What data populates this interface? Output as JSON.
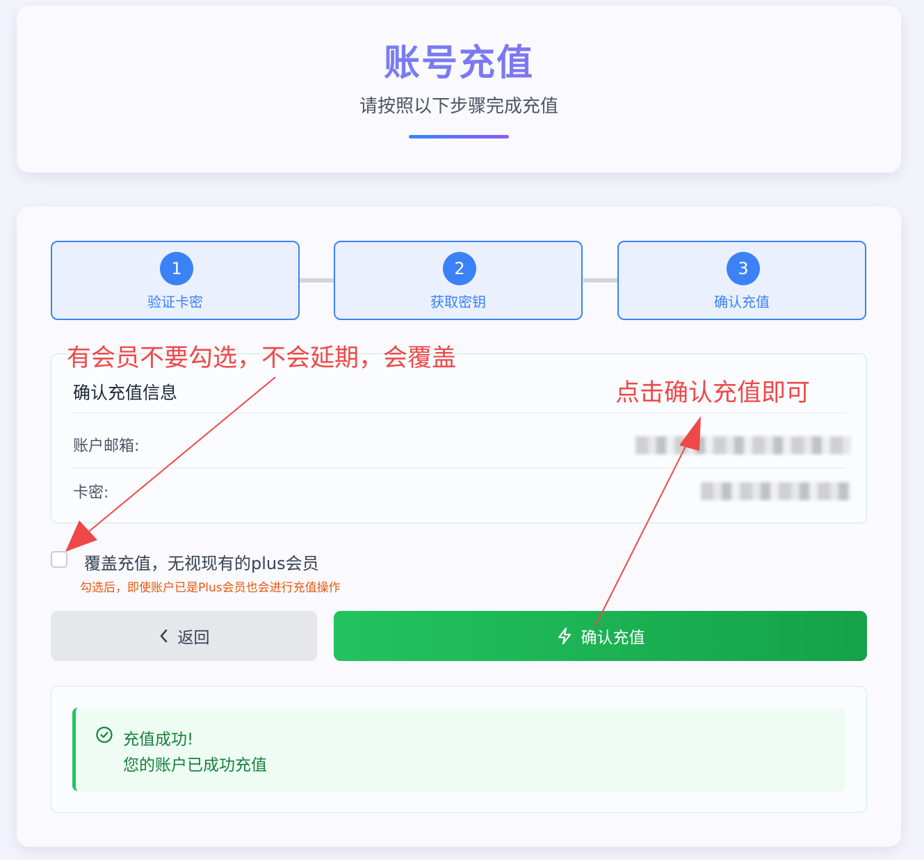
{
  "header": {
    "title": "账号充值",
    "subtitle": "请按照以下步骤完成充值"
  },
  "steps": [
    {
      "number": "1",
      "label": "验证卡密"
    },
    {
      "number": "2",
      "label": "获取密钥"
    },
    {
      "number": "3",
      "label": "确认充值"
    }
  ],
  "info": {
    "title": "确认充值信息",
    "email_label": "账户邮箱:",
    "card_label": "卡密:"
  },
  "override": {
    "label": "覆盖充值，无视现有的plus会员",
    "hint": "勾选后，即使账户已是Plus会员也会进行充值操作",
    "checked": false
  },
  "buttons": {
    "back": "返回",
    "confirm": "确认充值"
  },
  "result": {
    "title": "充值成功!",
    "message": "您的账户已成功充值"
  },
  "annotations": {
    "top_left": "有会员不要勾选，不会延期，会覆盖",
    "top_right": "点击确认充值即可"
  },
  "colors": {
    "primary": "#3b82f6",
    "success": "#22c55e",
    "annotation": "#f04848"
  }
}
